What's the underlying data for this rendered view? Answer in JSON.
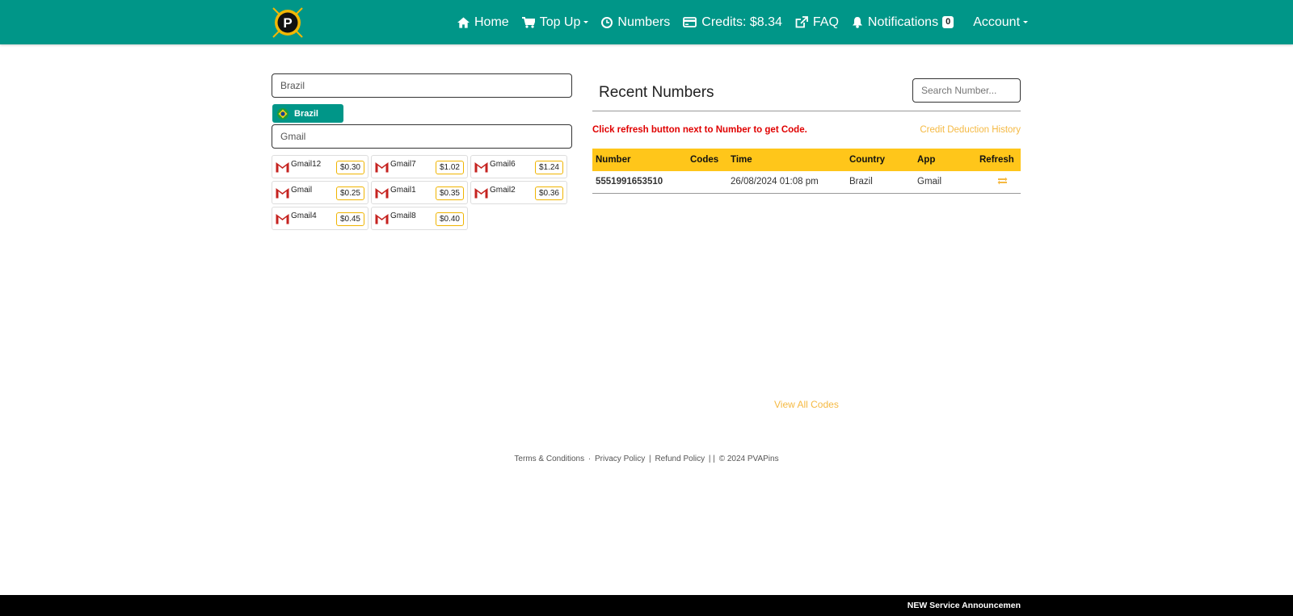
{
  "nav": {
    "home": "Home",
    "topup": "Top Up",
    "numbers": "Numbers",
    "credits": "Credits: $8.34",
    "faq": "FAQ",
    "notifications": "Notifications",
    "notif_count": "0",
    "account": "Account"
  },
  "left": {
    "country_value": "Brazil",
    "country_chip": "Brazil",
    "app_value": "Gmail",
    "services": [
      {
        "name": "Gmail12",
        "price": "$0.30"
      },
      {
        "name": "Gmail7",
        "price": "$1.02"
      },
      {
        "name": "Gmail6",
        "price": "$1.24"
      },
      {
        "name": "Gmail",
        "price": "$0.25"
      },
      {
        "name": "Gmail1",
        "price": "$0.35"
      },
      {
        "name": "Gmail2",
        "price": "$0.36"
      },
      {
        "name": "Gmail4",
        "price": "$0.45"
      },
      {
        "name": "Gmail8",
        "price": "$0.40"
      }
    ]
  },
  "recent": {
    "title": "Recent Numbers",
    "search_placeholder": "Search Number...",
    "info": "Click refresh button next to Number to get Code.",
    "credit_history": "Credit Deduction History",
    "columns": [
      "Number",
      "Codes",
      "Time",
      "Country",
      "App",
      "Refresh"
    ],
    "rows": [
      {
        "number": "5551991653510",
        "codes": "",
        "time": "26/08/2024 01:08 pm",
        "country": "Brazil",
        "app": "Gmail"
      }
    ],
    "view_all": "View All Codes"
  },
  "footer": {
    "terms": "Terms & Conditions",
    "sep1": "·",
    "privacy": "Privacy Policy",
    "sep2": "|",
    "refund": "Refund Policy",
    "sep3": "| |",
    "copyright": "© 2024 PVAPins"
  },
  "bottom": {
    "announcement": "NEW Service Announcemen"
  },
  "colors": {
    "brand": "#009688",
    "accent": "#ffc61a",
    "link": "#f5b942",
    "alert": "#e00000"
  },
  "icons": {
    "logo": "p-logo-icon",
    "home": "home-icon",
    "topup": "cart-icon",
    "numbers": "clock-icon",
    "credits": "credit-card-icon",
    "faq": "external-link-icon",
    "notifications": "bell-icon",
    "country": "brazil-flag-icon",
    "service": "gmail-icon",
    "refresh": "refresh-icon"
  }
}
